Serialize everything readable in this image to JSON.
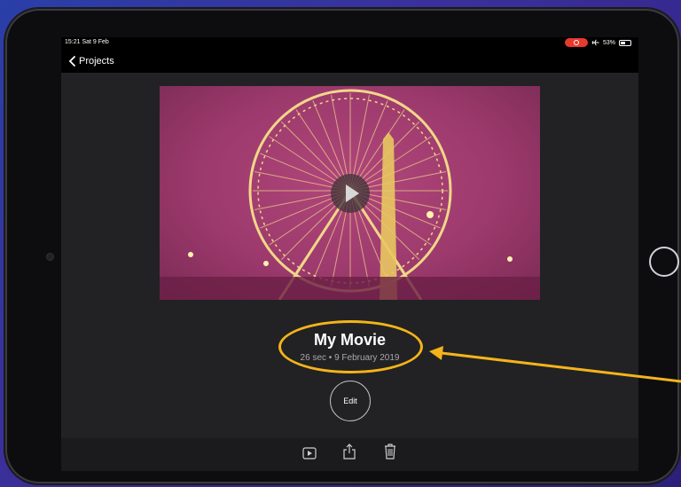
{
  "status_bar": {
    "time_date": "15:21  Sat 9 Feb",
    "battery_percent": "53%",
    "battery_level": 0.53
  },
  "nav": {
    "back_label": "Projects"
  },
  "project": {
    "title": "My Movie",
    "meta": "26 sec • 9 February 2019"
  },
  "actions": {
    "edit_label": "Edit"
  },
  "toolbar": {
    "icons": [
      "play-icon",
      "share-icon",
      "trash-icon"
    ]
  },
  "colors": {
    "highlight": "#f4b41a",
    "record_indicator": "#e8392e",
    "thumbnail_tint": "#9d3a6d"
  }
}
